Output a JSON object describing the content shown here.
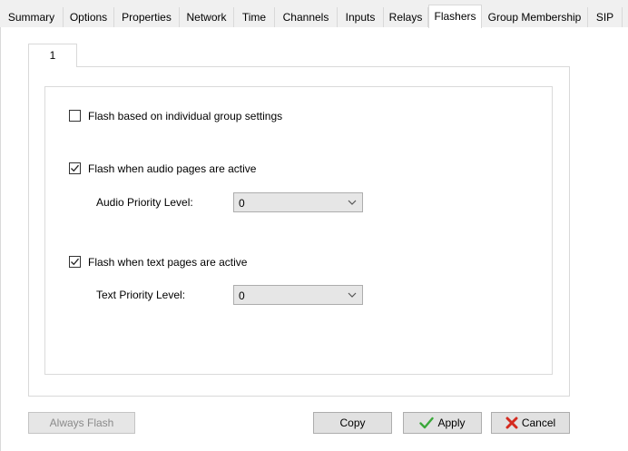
{
  "tabs": [
    {
      "label": "Summary"
    },
    {
      "label": "Options"
    },
    {
      "label": "Properties"
    },
    {
      "label": "Network"
    },
    {
      "label": "Time"
    },
    {
      "label": "Channels"
    },
    {
      "label": "Inputs"
    },
    {
      "label": "Relays"
    },
    {
      "label": "Flashers"
    },
    {
      "label": "Group Membership"
    },
    {
      "label": "SIP"
    }
  ],
  "active_tab": "Flashers",
  "subtab": {
    "label": "1"
  },
  "options": {
    "individual_group": {
      "label": "Flash based on individual group settings",
      "checked": false
    },
    "audio_pages": {
      "label": "Flash when audio pages are active",
      "checked": true
    },
    "audio_priority": {
      "label": "Audio Priority Level:",
      "value": "0"
    },
    "text_pages": {
      "label": "Flash when text pages are active",
      "checked": true
    },
    "text_priority": {
      "label": "Text Priority Level:",
      "value": "0"
    }
  },
  "buttons": {
    "always_flash": "Always Flash",
    "copy": "Copy",
    "apply": "Apply",
    "cancel": "Cancel"
  },
  "colors": {
    "apply_icon": "#3aa83a",
    "cancel_icon": "#d42a1f"
  }
}
